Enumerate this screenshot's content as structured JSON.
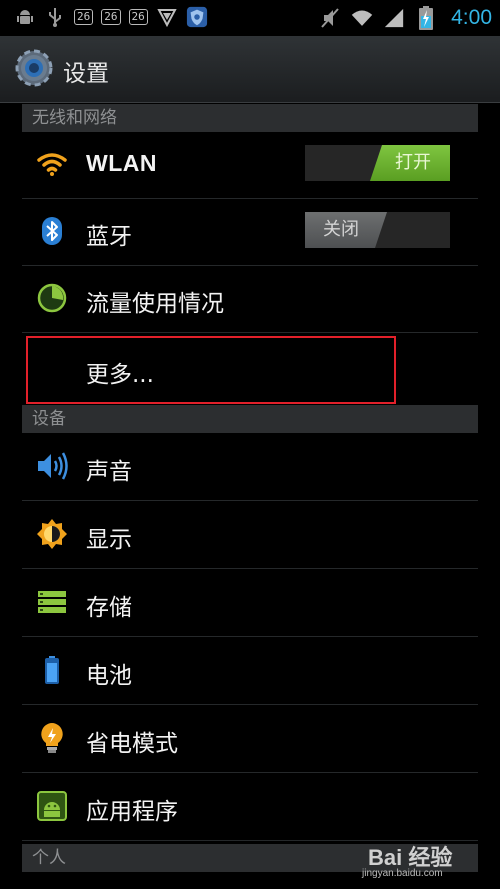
{
  "status_bar": {
    "notification_badges": [
      "26",
      "26",
      "26"
    ],
    "time": "4:00",
    "icons": [
      "android-debug-icon",
      "usb-icon",
      "shield-icon",
      "security-app-icon",
      "mute-icon",
      "wifi-signal-icon",
      "cell-signal-icon",
      "battery-charging-icon"
    ]
  },
  "action_bar": {
    "title": "设置",
    "icon": "settings-gear-icon"
  },
  "sections": {
    "wireless": {
      "header": "无线和网络",
      "wlan": {
        "label": "WLAN",
        "toggle": "打开",
        "icon": "wifi-icon"
      },
      "bluetooth": {
        "label": "蓝牙",
        "toggle": "关闭",
        "icon": "bluetooth-icon"
      },
      "data_usage": {
        "label": "流量使用情况",
        "icon": "data-usage-icon"
      },
      "more": {
        "label": "更多..."
      }
    },
    "device": {
      "header": "设备",
      "sound": {
        "label": "声音",
        "icon": "speaker-icon"
      },
      "display": {
        "label": "显示",
        "icon": "brightness-icon"
      },
      "storage": {
        "label": "存储",
        "icon": "storage-icon"
      },
      "battery": {
        "label": "电池",
        "icon": "battery-icon"
      },
      "power_saving": {
        "label": "省电模式",
        "icon": "lightbulb-icon"
      },
      "apps": {
        "label": "应用程序",
        "icon": "android-app-icon"
      }
    },
    "personal": {
      "header": "个人"
    }
  },
  "watermark": {
    "brand": "Bai 经验",
    "url": "jingyan.baidu.com"
  },
  "colors": {
    "accent": "#33b5e5",
    "toggle_on": "#6cb033",
    "highlight": "#e2202a"
  }
}
